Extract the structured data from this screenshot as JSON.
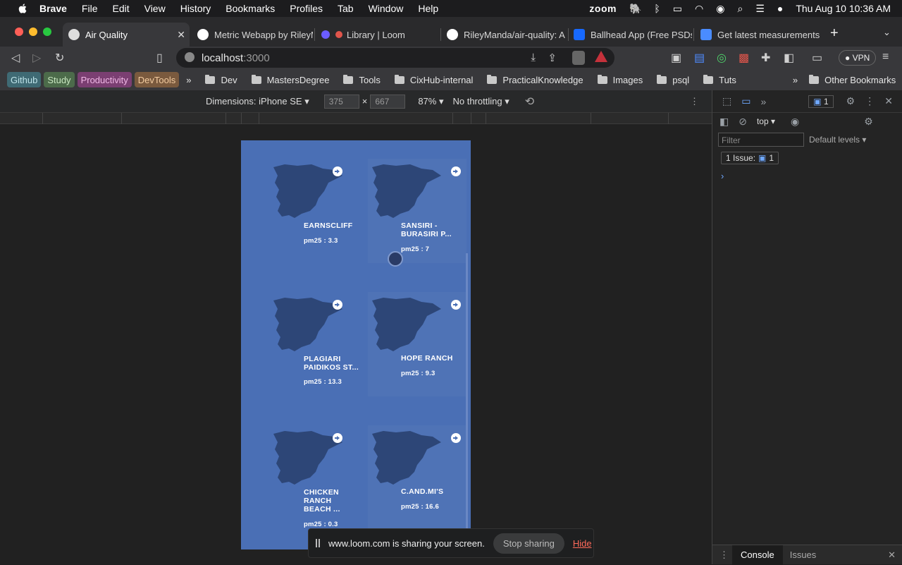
{
  "menubar": {
    "app": "Brave",
    "items": [
      "File",
      "Edit",
      "View",
      "History",
      "Bookmarks",
      "Profiles",
      "Tab",
      "Window",
      "Help"
    ],
    "zoom": "zoom",
    "datetime": "Thu Aug 10  10:36 AM"
  },
  "tabs": [
    {
      "title": "Air Quality",
      "active": true
    },
    {
      "title": "Metric Webapp by RileyM"
    },
    {
      "title": "Library | Loom"
    },
    {
      "title": "RileyManda/air-quality: A"
    },
    {
      "title": "Ballhead App (Free PSDs"
    },
    {
      "title": "Get latest measurements"
    }
  ],
  "address": {
    "host": "localhost",
    "port": ":3000",
    "vpn_label": "VPN"
  },
  "bookmarks": {
    "pills": [
      {
        "label": "Github",
        "color": "#3f6a74"
      },
      {
        "label": "Study",
        "color": "#4c6b4a"
      },
      {
        "label": "Productivity",
        "color": "#7b3f72"
      },
      {
        "label": "DevTools",
        "color": "#7a5a3e"
      }
    ],
    "more1": "»",
    "folders": [
      "Dev",
      "MastersDegree",
      "Tools",
      "CixHub-internal",
      "PracticalKnowledge",
      "Images",
      "psql",
      "Tuts"
    ],
    "more2": "»",
    "other": "Other Bookmarks"
  },
  "device_toolbar": {
    "dimensions_label": "Dimensions: iPhone SE",
    "width": "375",
    "times": "×",
    "height": "667",
    "zoom": "87%",
    "throttling": "No throttling"
  },
  "cards": [
    {
      "name_lines": [
        "EARNSCLIFF"
      ],
      "pm": "pm25 : 3.3"
    },
    {
      "name_lines": [
        "SANSIRI -",
        "BURASIRI P..."
      ],
      "pm": "pm25 : 7"
    },
    {
      "name_lines": [
        "PLAGIARI",
        "PAIDIKOS ST..."
      ],
      "pm": "pm25 : 13.3"
    },
    {
      "name_lines": [
        "HOPE RANCH"
      ],
      "pm": "pm25 : 9.3"
    },
    {
      "name_lines": [
        "CHICKEN",
        "RANCH",
        "BEACH ..."
      ],
      "pm": "pm25 : 0.3"
    },
    {
      "name_lines": [
        "C.AND.MI'S"
      ],
      "pm": "pm25 : 16.6"
    }
  ],
  "loom": {
    "message": "www.loom.com is sharing your screen.",
    "stop": "Stop sharing",
    "hide": "Hide"
  },
  "devtools": {
    "issues_count": "1",
    "context": "top",
    "filter_placeholder": "Filter",
    "levels": "Default levels",
    "issue_badge": "1 Issue:",
    "issue_badge_count": "1",
    "prompt": "›",
    "tab_console": "Console",
    "tab_issues": "Issues"
  }
}
